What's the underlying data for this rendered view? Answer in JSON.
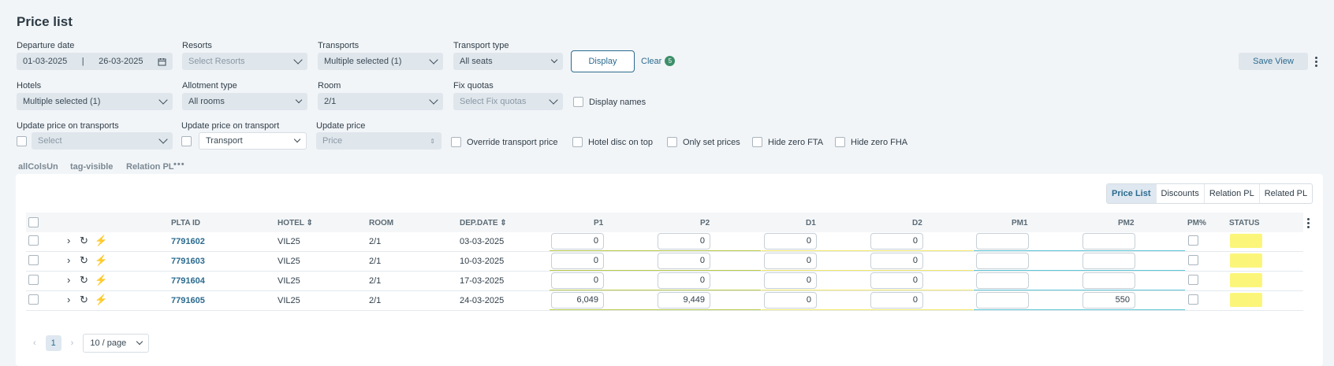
{
  "page": {
    "title": "Price list"
  },
  "filters": {
    "departure_date": {
      "label": "Departure date",
      "from": "01-03-2025",
      "to": "26-03-2025"
    },
    "resorts": {
      "label": "Resorts",
      "placeholder": "Select Resorts"
    },
    "transports": {
      "label": "Transports",
      "value": "Multiple selected (1)"
    },
    "transport_type": {
      "label": "Transport type",
      "value": "All seats"
    },
    "display_label": "Display",
    "clear_label": "Clear",
    "clear_count": "5",
    "save_view_label": "Save View",
    "hotels": {
      "label": "Hotels",
      "value": "Multiple selected (1)"
    },
    "allotment_type": {
      "label": "Allotment type",
      "value": "All rooms"
    },
    "room": {
      "label": "Room",
      "value": "2/1"
    },
    "fix_quotas": {
      "label": "Fix quotas",
      "placeholder": "Select Fix quotas"
    },
    "display_names_label": "Display names",
    "update_price_on_transports": {
      "label": "Update price on transports",
      "placeholder": "Select"
    },
    "update_price_on_transport": {
      "label": "Update price on transport",
      "value": "Transport"
    },
    "update_price": {
      "label": "Update price",
      "placeholder": "Price"
    },
    "override_transport_price_label": "Override transport price",
    "hotel_disc_on_top_label": "Hotel disc on top",
    "only_set_prices_label": "Only set prices",
    "hide_zero_fta_label": "Hide zero FTA",
    "hide_zero_fha_label": "Hide zero FHA"
  },
  "view_links": [
    "allColsUn",
    "tag-visible",
    "Relation PL"
  ],
  "tabs": [
    "Price List",
    "Discounts",
    "Relation PL",
    "Related PL"
  ],
  "active_tab": "Price List",
  "table": {
    "headers": {
      "plta_id": "PLTA ID",
      "hotel": "HOTEL",
      "room": "ROOM",
      "dep_date": "DEP.DATE",
      "p1": "P1",
      "p2": "P2",
      "d1": "D1",
      "d2": "D2",
      "pm1": "PM1",
      "pm2": "PM2",
      "pm_pct": "PM%",
      "status": "STATUS"
    },
    "rows": [
      {
        "id": "7791602",
        "hotel": "VIL25",
        "room": "2/1",
        "dep_date": "03-03-2025",
        "p1": "0",
        "p2": "0",
        "d1": "0",
        "d2": "0",
        "pm1": "",
        "pm2": ""
      },
      {
        "id": "7791603",
        "hotel": "VIL25",
        "room": "2/1",
        "dep_date": "10-03-2025",
        "p1": "0",
        "p2": "0",
        "d1": "0",
        "d2": "0",
        "pm1": "",
        "pm2": ""
      },
      {
        "id": "7791604",
        "hotel": "VIL25",
        "room": "2/1",
        "dep_date": "17-03-2025",
        "p1": "0",
        "p2": "0",
        "d1": "0",
        "d2": "0",
        "pm1": "",
        "pm2": ""
      },
      {
        "id": "7791605",
        "hotel": "VIL25",
        "room": "2/1",
        "dep_date": "24-03-2025",
        "p1": "6,049",
        "p2": "9,449",
        "d1": "0",
        "d2": "0",
        "pm1": "",
        "pm2": "550"
      }
    ]
  },
  "pagination": {
    "current_page": "1",
    "page_size": "10 / page"
  },
  "colors": {
    "accent": "#2b6b8f",
    "status_yellow": "#fbf67a",
    "badge_green": "#3d8f6a"
  }
}
